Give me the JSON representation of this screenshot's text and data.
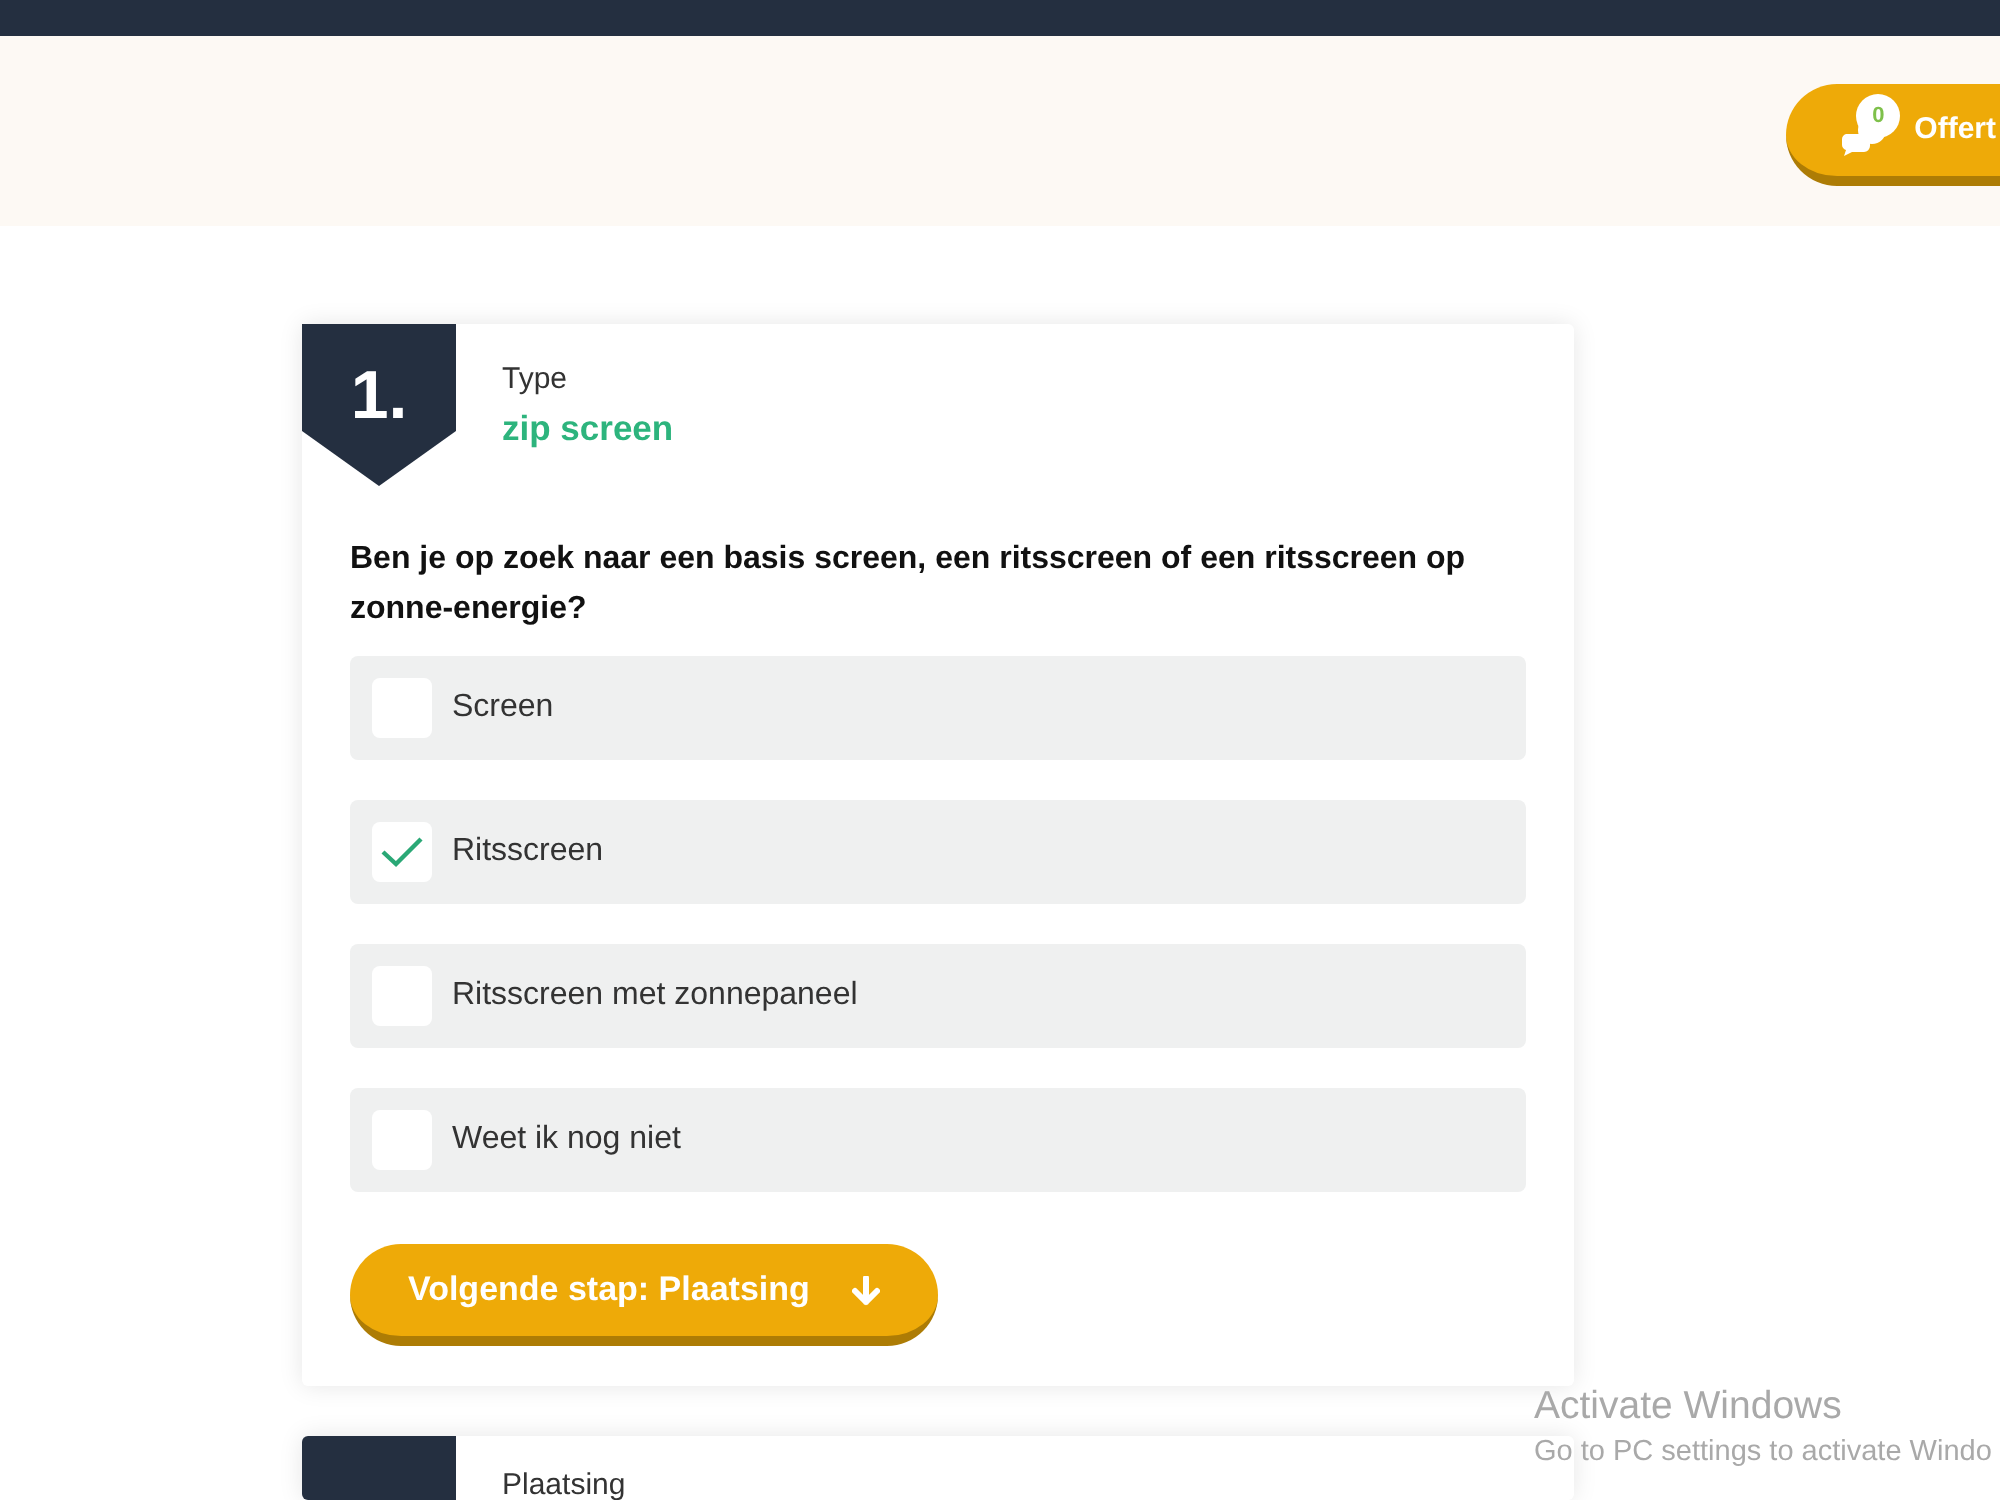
{
  "header": {
    "offer_button": {
      "label": "Offert",
      "count": "0"
    }
  },
  "steps": [
    {
      "number": "1.",
      "title": "Type",
      "value": "zip screen",
      "question": "Ben je op zoek naar een basis screen, een ritsscreen of een ritsscreen op zonne-energie?",
      "options": [
        {
          "label": "Screen",
          "checked": false
        },
        {
          "label": "Ritsscreen",
          "checked": true
        },
        {
          "label": "Ritsscreen met zonnepaneel",
          "checked": false
        },
        {
          "label": "Weet ik nog niet",
          "checked": false
        }
      ],
      "next_button": {
        "label": "Volgende stap: Plaatsing"
      }
    },
    {
      "title": "Plaatsing"
    }
  ],
  "os_overlay": {
    "title": "Activate Windows",
    "message": "Go to PC settings to activate Windo"
  }
}
